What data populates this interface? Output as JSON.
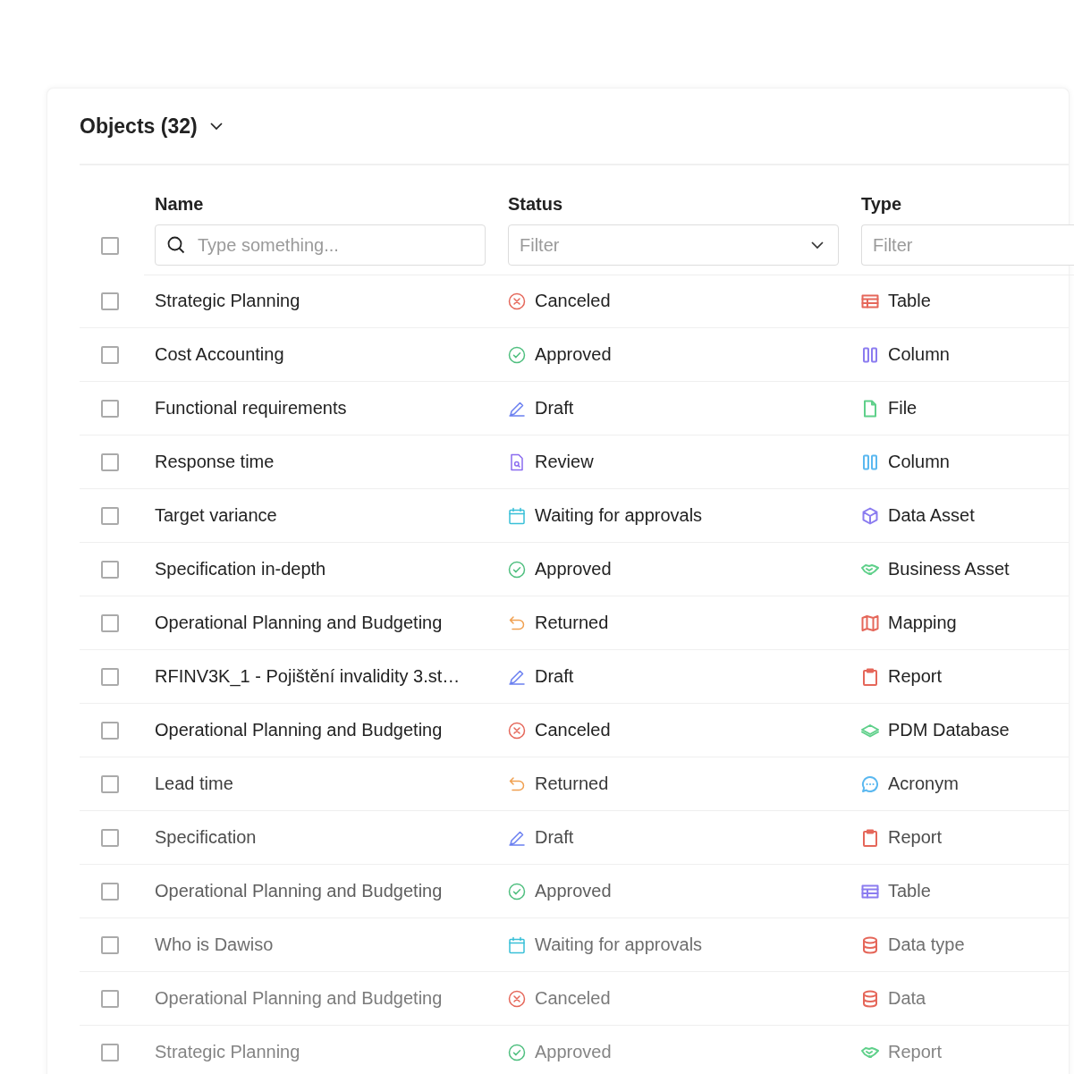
{
  "title": "Objects (32)",
  "select_all": {
    "checked": false
  },
  "columns": [
    {
      "label": "Name",
      "filter": {
        "kind": "search",
        "placeholder": "Type something..."
      }
    },
    {
      "label": "Status",
      "filter": {
        "kind": "select",
        "placeholder": "Filter"
      }
    },
    {
      "label": "Type",
      "filter": {
        "kind": "select-cut",
        "placeholder": "Filter"
      }
    }
  ],
  "rows": [
    {
      "checked": false,
      "name": "Strategic Planning",
      "status": {
        "kind": "canceled",
        "label": "Canceled"
      },
      "type": {
        "kind": "table",
        "label": "Table",
        "color": "#e5675a"
      }
    },
    {
      "checked": false,
      "name": "Cost Accounting",
      "status": {
        "kind": "approved",
        "label": "Approved"
      },
      "type": {
        "kind": "column",
        "label": "Column",
        "color": "#8b7cf0"
      }
    },
    {
      "checked": false,
      "name": "Functional requirements",
      "status": {
        "kind": "draft",
        "label": "Draft"
      },
      "type": {
        "kind": "file",
        "label": "File",
        "color": "#5fd08a"
      }
    },
    {
      "checked": false,
      "name": "Response time",
      "status": {
        "kind": "review",
        "label": "Review"
      },
      "type": {
        "kind": "column",
        "label": "Column",
        "color": "#5ab8f0"
      }
    },
    {
      "checked": false,
      "name": "Target variance",
      "status": {
        "kind": "waiting",
        "label": "Waiting for approvals"
      },
      "type": {
        "kind": "cube",
        "label": "Data Asset",
        "color": "#8b7cf0"
      }
    },
    {
      "checked": false,
      "name": "Specification in-depth",
      "status": {
        "kind": "approved",
        "label": "Approved"
      },
      "type": {
        "kind": "handshake",
        "label": "Business Asset",
        "color": "#5fd08a"
      }
    },
    {
      "checked": false,
      "name": "Operational Planning and Budgeting",
      "status": {
        "kind": "returned",
        "label": "Returned"
      },
      "type": {
        "kind": "map",
        "label": "Mapping",
        "color": "#e5675a"
      }
    },
    {
      "checked": false,
      "name": "RFINV3K_1 - Pojištění invalidity 3.st…",
      "status": {
        "kind": "draft",
        "label": "Draft"
      },
      "type": {
        "kind": "clipboard",
        "label": "Report",
        "color": "#e5675a"
      }
    },
    {
      "checked": false,
      "name": "Operational Planning and Budgeting",
      "status": {
        "kind": "canceled",
        "label": "Canceled"
      },
      "type": {
        "kind": "layers",
        "label": "PDM Database",
        "color": "#5fd08a"
      }
    },
    {
      "checked": false,
      "name": "Lead time",
      "status": {
        "kind": "returned",
        "label": "Returned"
      },
      "type": {
        "kind": "chat",
        "label": "Acronym",
        "color": "#5ab8f0"
      }
    },
    {
      "checked": false,
      "name": "Specification",
      "status": {
        "kind": "draft",
        "label": "Draft"
      },
      "type": {
        "kind": "clipboard",
        "label": "Report",
        "color": "#e5675a"
      }
    },
    {
      "checked": false,
      "name": "Operational Planning and Budgeting",
      "status": {
        "kind": "approved",
        "label": "Approved"
      },
      "type": {
        "kind": "table",
        "label": "Table",
        "color": "#8b7cf0"
      }
    },
    {
      "checked": false,
      "name": "Who is Dawiso",
      "status": {
        "kind": "waiting",
        "label": "Waiting for approvals"
      },
      "type": {
        "kind": "database",
        "label": "Data type",
        "color": "#e5675a"
      }
    },
    {
      "checked": false,
      "name": "Operational Planning and Budgeting",
      "status": {
        "kind": "canceled",
        "label": "Canceled"
      },
      "type": {
        "kind": "database",
        "label": "Data",
        "color": "#e5675a"
      }
    },
    {
      "checked": false,
      "name": "Strategic Planning",
      "status": {
        "kind": "approved",
        "label": "Approved"
      },
      "type": {
        "kind": "handshake",
        "label": "Report",
        "color": "#5fd08a"
      }
    }
  ]
}
